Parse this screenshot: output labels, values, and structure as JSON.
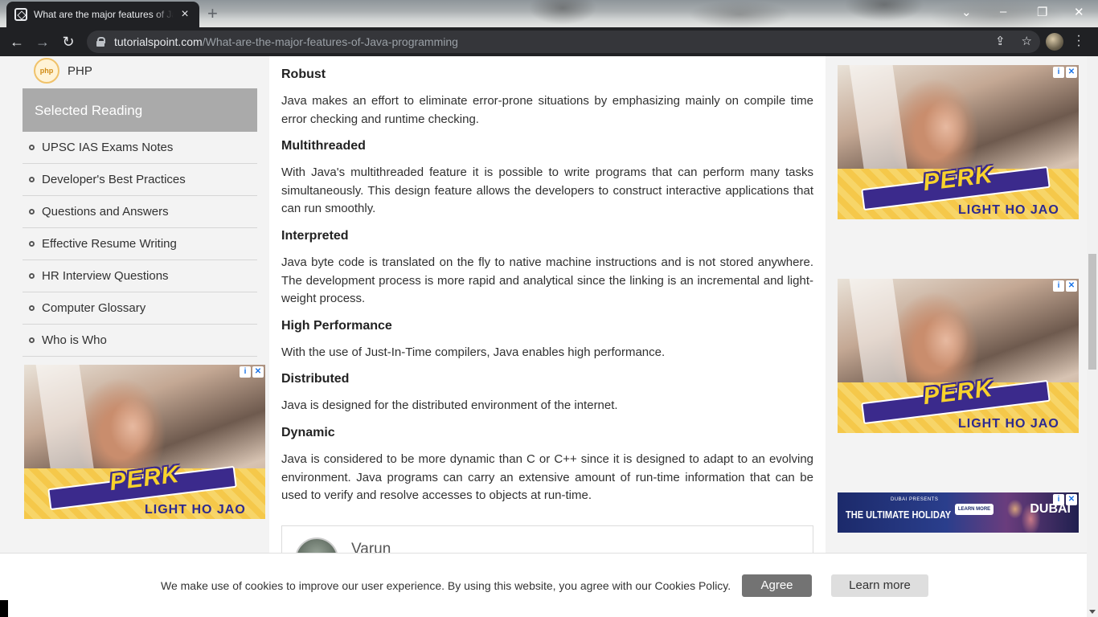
{
  "browser": {
    "tab_title": "What are the major features of Java programming",
    "url_host": "tutorialspoint.com",
    "url_path": "/What-are-the-major-features-of-Java-programming"
  },
  "sidebar": {
    "php_label": "PHP",
    "php_logo_text": "php",
    "selected_reading_title": "Selected Reading",
    "items": [
      {
        "label": "UPSC IAS Exams Notes"
      },
      {
        "label": "Developer's Best Practices"
      },
      {
        "label": "Questions and Answers"
      },
      {
        "label": "Effective Resume Writing"
      },
      {
        "label": "HR Interview Questions"
      },
      {
        "label": "Computer Glossary"
      },
      {
        "label": "Who is Who"
      }
    ]
  },
  "article": {
    "sections": [
      {
        "heading": "Robust",
        "text": "Java makes an effort to eliminate error-prone situations by emphasizing mainly on compile time error checking and runtime checking."
      },
      {
        "heading": "Multithreaded",
        "text": "With Java's multithreaded feature it is possible to write programs that can perform many tasks simultaneously. This design feature allows the developers to construct interactive applications that can run smoothly."
      },
      {
        "heading": "Interpreted",
        "text": "Java byte code is translated on the fly to native machine instructions and is not stored anywhere. The development process is more rapid and analytical since the linking is an incremental and light-weight process."
      },
      {
        "heading": "High Performance",
        "text": "With the use of Just-In-Time compilers, Java enables high performance."
      },
      {
        "heading": "Distributed",
        "text": "Java is designed for the distributed environment of the internet."
      },
      {
        "heading": "Dynamic",
        "text": "Java is considered to be more dynamic than C or C++ since it is designed to adapt to an evolving environment. Java programs can carry an extensive amount of run-time information that can be used to verify and resolve accesses to objects at run-time."
      }
    ],
    "author_name": "Varun"
  },
  "ads": {
    "perk_brand": "PERK",
    "perk_tagline": "LIGHT HO JAO",
    "banner_pre": "DUBAI PRESENTS",
    "banner_headline": "THE ULTIMATE HOLIDAY",
    "banner_cta": "LEARN MORE",
    "banner_logo": "DUBAI"
  },
  "cookie": {
    "message": "We make use of cookies to improve our user experience. By using this website, you agree with our Cookies Policy.",
    "agree_label": "Agree",
    "learn_label": "Learn more"
  }
}
